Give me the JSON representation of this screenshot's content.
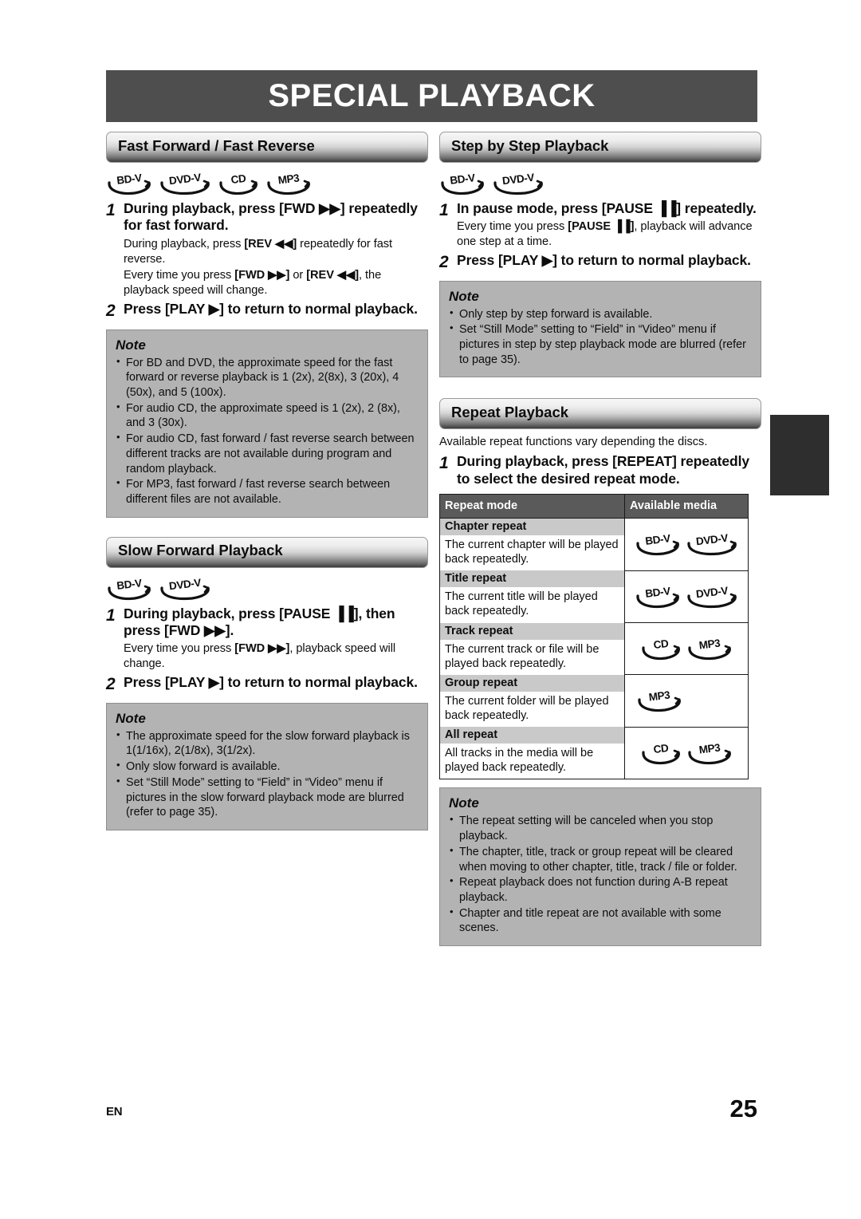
{
  "page": {
    "title": "SPECIAL PLAYBACK",
    "language_code": "EN",
    "page_number": "25",
    "title_bar_color": "#4e4e4e",
    "note_box_color": "#b3b3b3",
    "table_header_color": "#5a5a5a"
  },
  "badges": {
    "bdv": "BD-V",
    "dvdv": "DVD-V",
    "cd": "CD",
    "mp3": "MP3"
  },
  "sections": {
    "fast_forward": {
      "heading": "Fast Forward / Fast Reverse",
      "media": [
        "BD-V",
        "DVD-V",
        "CD",
        "MP3"
      ],
      "step1_num": "1",
      "step1_title": "During playback, press [FWD ▶▶] repeatedly for fast forward.",
      "step1_sub1": "During playback, press [REV ◀◀] repeatedly for fast reverse.",
      "step1_sub2": "Every time you press [FWD ▶▶] or [REV ◀◀], the playback speed will change.",
      "step2_num": "2",
      "step2_title": "Press [PLAY ▶] to return to normal playback.",
      "note_title": "Note",
      "note_items": [
        "For BD and DVD, the approximate speed for the fast forward or reverse playback is 1 (2x), 2(8x), 3 (20x), 4 (50x), and 5 (100x).",
        "For audio CD, the approximate speed is 1 (2x), 2 (8x), and 3 (30x).",
        "For audio CD, fast forward / fast reverse search between different tracks are not available during program and random playback.",
        "For MP3, fast forward / fast reverse search between different files are not available."
      ]
    },
    "slow_forward": {
      "heading": "Slow Forward Playback",
      "media": [
        "BD-V",
        "DVD-V"
      ],
      "step1_num": "1",
      "step1_title": "During playback, press [PAUSE ▐▐], then press [FWD ▶▶].",
      "step1_sub1": "Every time you press [FWD ▶▶], playback speed will change.",
      "step2_num": "2",
      "step2_title": "Press [PLAY ▶] to return to normal playback.",
      "note_title": "Note",
      "note_items": [
        "The approximate speed for the slow forward playback is 1(1/16x), 2(1/8x), 3(1/2x).",
        "Only slow forward is available.",
        "Set “Still Mode” setting to “Field” in “Video” menu if pictures in the slow forward playback mode are blurred (refer to page 35)."
      ]
    },
    "step_by_step": {
      "heading": "Step by Step Playback",
      "media": [
        "BD-V",
        "DVD-V"
      ],
      "step1_num": "1",
      "step1_title": "In pause mode, press [PAUSE ▐▐] repeatedly.",
      "step1_sub1": "Every time you press [PAUSE ▐▐], playback will advance one step at a time.",
      "step2_num": "2",
      "step2_title": "Press [PLAY ▶] to return to normal playback.",
      "note_title": "Note",
      "note_items": [
        "Only step by step forward is available.",
        "Set “Still Mode” setting to “Field” in “Video” menu if pictures in step by step playback mode are blurred (refer to page 35)."
      ]
    },
    "repeat_playback": {
      "heading": "Repeat Playback",
      "lead": "Available repeat functions vary depending the discs.",
      "step1_num": "1",
      "step1_title": "During playback, press [REPEAT] repeatedly to select the desired repeat mode.",
      "table": {
        "col_mode": "Repeat mode",
        "col_media": "Available media",
        "rows": [
          {
            "mode": "Chapter repeat",
            "desc": "The current chapter will be played back repeatedly.",
            "media": [
              "BD-V",
              "DVD-V"
            ]
          },
          {
            "mode": "Title repeat",
            "desc": "The current title will be played back repeatedly.",
            "media": [
              "BD-V",
              "DVD-V"
            ]
          },
          {
            "mode": "Track repeat",
            "desc": "The current track or file will be played back repeatedly.",
            "media": [
              "CD",
              "MP3"
            ]
          },
          {
            "mode": "Group repeat",
            "desc": "The current folder will be played back repeatedly.",
            "media": [
              "MP3"
            ]
          },
          {
            "mode": "All repeat",
            "desc": "All tracks in the media will be played back repeatedly.",
            "media": [
              "CD",
              "MP3"
            ]
          }
        ]
      },
      "note_title": "Note",
      "note_items": [
        "The repeat setting will be canceled when you stop playback.",
        "The chapter, title, track or group repeat will be cleared when moving to other chapter, title, track / file or folder.",
        "Repeat playback does not function during A-B repeat playback.",
        "Chapter and title repeat are not available with some scenes."
      ]
    }
  }
}
